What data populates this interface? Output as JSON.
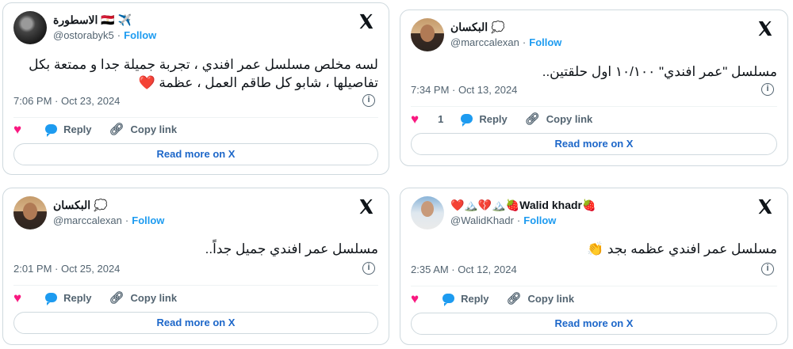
{
  "x_icon": "x-logo-icon",
  "colors": {
    "accent": "#1d9bf0",
    "heart": "#f91880",
    "muted": "#536471",
    "border": "#cfd9de"
  },
  "common": {
    "follow": "Follow",
    "reply": "Reply",
    "copy_link": "Copy link",
    "read_more": "Read more on X",
    "dot": "·"
  },
  "tweets": [
    {
      "name": "الاسطورة 🇪🇬 ✈️",
      "handle": "@ostorabyk5",
      "text": "لسه مخلص مسلسل عمر افندي ، تجربة جميلة جدا و ممتعة بكل تفاصيلها ، شابو كل طاقم العمل ، عظمة ❤️",
      "time": "7:06 PM · Oct 23, 2024",
      "likes": ""
    },
    {
      "name": "البكسان 💭",
      "handle": "@marccalexan",
      "text": "مسلسل \"عمر افندي\" ١٠/١٠٠ اول حلقتين..",
      "time": "7:34 PM · Oct 13, 2024",
      "likes": "1"
    },
    {
      "name": "البكسان 💭",
      "handle": "@marccalexan",
      "text": "مسلسل عمر افندي جميل جداً..",
      "time": "2:01 PM · Oct 25, 2024",
      "likes": ""
    },
    {
      "name": "❤️🏔️💔🏔️🍓Walid khadr🍓",
      "handle": "@WalidKhadr",
      "text": "مسلسل عمر افندي عظمه بجد 👏",
      "time": "2:35 AM · Oct 12, 2024",
      "likes": ""
    }
  ]
}
